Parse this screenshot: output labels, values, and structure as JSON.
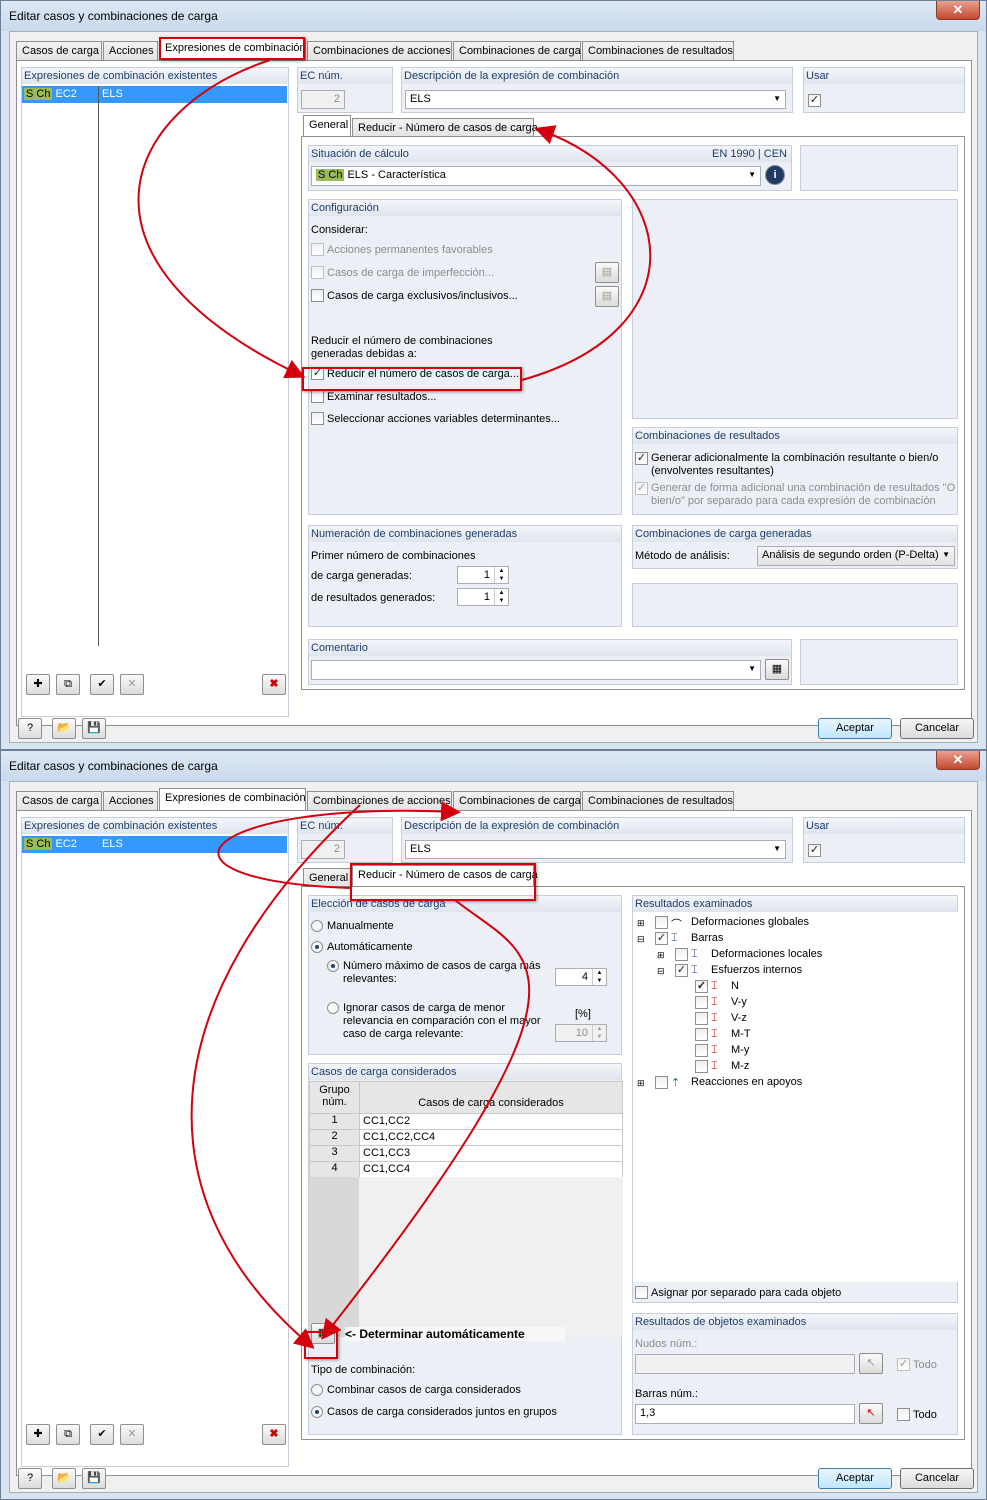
{
  "window_title": "Editar casos y combinaciones de carga",
  "close_glyph": "✕",
  "tabs": [
    "Casos de carga",
    "Acciones",
    "Expresiones de combinación",
    "Combinaciones de acciones",
    "Combinaciones de carga",
    "Combinaciones de resultados"
  ],
  "left": {
    "header": "Expresiones de combinación existentes",
    "item": {
      "badge": "S Ch",
      "code": "EC2",
      "name": "ELS"
    }
  },
  "ec": {
    "label": "EC núm.",
    "value": "2"
  },
  "desc": {
    "label": "Descripción de la expresión de combinación",
    "value": "ELS"
  },
  "usar": {
    "label": "Usar"
  },
  "subtabs": [
    "General",
    "Reducir - Número de casos de carga"
  ],
  "top": {
    "situacion": {
      "label": "Situación de cálculo",
      "norm": "EN 1990 | CEN",
      "badge": "S Ch",
      "value": "ELS - Característica"
    },
    "config": {
      "label": "Configuración",
      "considerar": "Considerar:",
      "opt1": "Acciones permanentes favorables",
      "opt2": "Casos de carga de imperfección...",
      "opt3": "Casos de carga exclusivos/inclusivos...",
      "reducir_line1": "Reducir el número de combinaciones",
      "reducir_line2": "generadas debidas a:",
      "opt4": "Reducir el número de casos de carga...",
      "opt5": "Examinar resultados...",
      "opt6": "Seleccionar acciones variables determinantes..."
    },
    "comb_res": {
      "label": "Combinaciones de resultados",
      "opt1a": "Generar adicionalmente la combinación resultante o bien/o",
      "opt1b": "(envolventes resultantes)",
      "opt2a": "Generar de forma adicional una combinación de resultados \"O",
      "opt2b": "bien/o\" por separado para cada expresión de combinación"
    },
    "numeracion": {
      "label": "Numeración de combinaciones generadas",
      "line1": "Primer número de combinaciones",
      "line2": "de carga generadas:",
      "val1": "1",
      "line3": "de resultados generados:",
      "val2": "1"
    },
    "comb_carga": {
      "label": "Combinaciones de carga generadas",
      "metodo": "Método de análisis:",
      "value": "Análisis de segundo orden (P-Delta)"
    },
    "comentario": {
      "label": "Comentario"
    }
  },
  "bottom": {
    "eleccion": {
      "label": "Elección de casos de carga",
      "manual": "Manualmente",
      "auto": "Automáticamente",
      "max_a": "Número máximo de casos de carga más",
      "max_b": "relevantes:",
      "max_val": "4",
      "ign_a": "Ignorar casos de carga de menor",
      "ign_b": "relevancia en comparación con el mayor",
      "ign_c": "caso de carga relevante:",
      "ign_unit": "[%]",
      "ign_val": "10"
    },
    "considerados": {
      "label": "Casos de carga considerados",
      "col1a": "Grupo",
      "col1b": "núm.",
      "col2": "Casos de carga considerados",
      "rows": [
        {
          "n": "1",
          "v": "CC1,CC2"
        },
        {
          "n": "2",
          "v": "CC1,CC2,CC4"
        },
        {
          "n": "3",
          "v": "CC1,CC3"
        },
        {
          "n": "4",
          "v": "CC1,CC4"
        }
      ]
    },
    "determinar": "<- Determinar automáticamente",
    "tipo": {
      "label": "Tipo de combinación:",
      "opt1": "Combinar casos de carga considerados",
      "opt2": "Casos de carga considerados juntos en grupos"
    },
    "resultados": {
      "label": "Resultados examinados",
      "tree": [
        "Deformaciones globales",
        "Barras",
        "Deformaciones locales",
        "Esfuerzos internos",
        "N",
        "V-y",
        "V-z",
        "M-T",
        "M-y",
        "M-z",
        "Reacciones en apoyos"
      ],
      "asignar": "Asignar por separado para cada objeto"
    },
    "objetos": {
      "label": "Resultados de objetos examinados",
      "nudos": "Nudos núm.:",
      "todo": "Todo",
      "barras": "Barras núm.:",
      "barras_val": "1,3"
    }
  },
  "buttons": {
    "ok": "Aceptar",
    "cancel": "Cancelar"
  },
  "colors": {
    "accent_red": "#d4000e",
    "select_blue": "#3399ff",
    "badge_green": "#9bbb59"
  }
}
